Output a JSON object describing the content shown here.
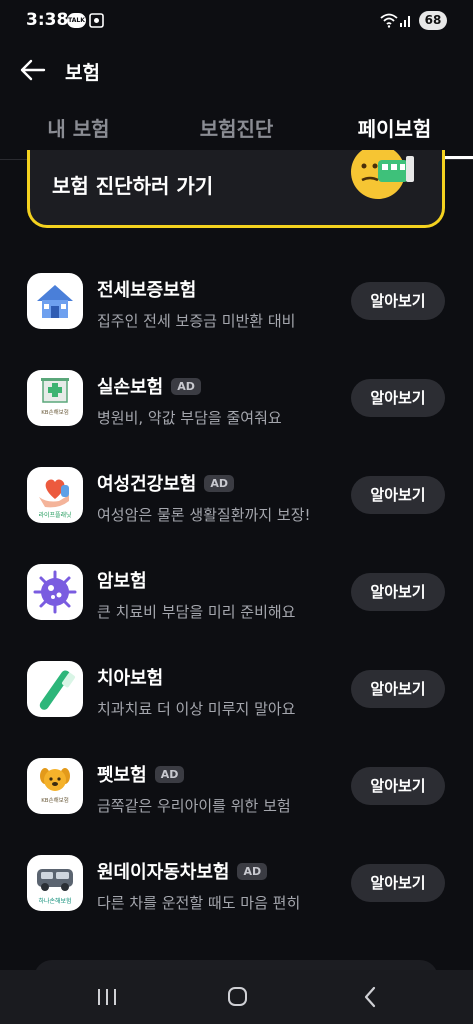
{
  "status_bar": {
    "time": "3:38",
    "talk_label": "TALK",
    "battery": "68"
  },
  "app_bar": {
    "title": "보험"
  },
  "tabs": [
    {
      "label": "내 보험"
    },
    {
      "label": "보험진단"
    },
    {
      "label": "페이보험"
    }
  ],
  "banner": {
    "text": "보험 진단하러 가기"
  },
  "items": [
    {
      "title": "전세보증보험",
      "subtitle": "집주인 전세 보증금 미반환 대비",
      "ad": "",
      "button": "알아보기",
      "icon": "house-icon"
    },
    {
      "title": "실손보험",
      "subtitle": "병원비, 약값 부담을 줄여줘요",
      "ad": "AD",
      "button": "알아보기",
      "icon": "hospital-icon",
      "brand": "KB손해보험"
    },
    {
      "title": "여성건강보험",
      "subtitle": "여성암은 물론 생활질환까지 보장!",
      "ad": "AD",
      "button": "알아보기",
      "icon": "heart-hand-icon",
      "brand": "라이프플래닛"
    },
    {
      "title": "암보험",
      "subtitle": "큰 치료비 부담을 미리 준비해요",
      "ad": "",
      "button": "알아보기",
      "icon": "virus-icon"
    },
    {
      "title": "치아보험",
      "subtitle": "치과치료 더 이상 미루지 말아요",
      "ad": "",
      "button": "알아보기",
      "icon": "toothbrush-icon"
    },
    {
      "title": "펫보험",
      "subtitle": "금쪽같은 우리아이를 위한 보험",
      "ad": "AD",
      "button": "알아보기",
      "icon": "dog-icon",
      "brand": "KB손해보험"
    },
    {
      "title": "원데이자동차보험",
      "subtitle": "다른 차를 운전할 때도 마음 편히",
      "ad": "AD",
      "button": "알아보기",
      "icon": "car-icon",
      "brand": "하나손해보험"
    }
  ],
  "colors": {
    "accent": "#f4d21f",
    "background": "#0d0e12"
  }
}
